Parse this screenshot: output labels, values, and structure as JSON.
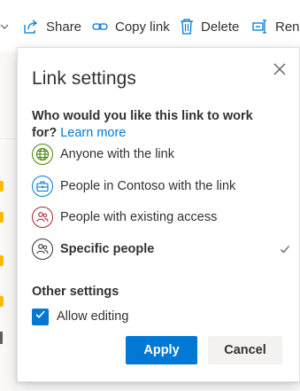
{
  "toolbar": {
    "share_label": "Share",
    "copy_link_label": "Copy link",
    "delete_label": "Delete",
    "rename_label": "Rena"
  },
  "panel": {
    "title": "Link settings",
    "question_text": "Who would you like this link to work for?",
    "learn_more": "Learn more",
    "options": [
      {
        "label": "Anyone with the link",
        "icon": "globe-icon",
        "color": "#498205"
      },
      {
        "label": "People in Contoso with the link",
        "icon": "briefcase-icon",
        "color": "#0078d4"
      },
      {
        "label": "People with existing access",
        "icon": "people-icon",
        "color": "#a4262c"
      },
      {
        "label": "Specific people",
        "icon": "people-icon",
        "color": "#323130",
        "selected": true
      }
    ],
    "other_settings": "Other settings",
    "allow_editing_label": "Allow editing",
    "allow_editing_checked": true,
    "apply_label": "Apply",
    "cancel_label": "Cancel"
  },
  "colors": {
    "accent": "#0078d4",
    "folder": "#ffb900"
  }
}
